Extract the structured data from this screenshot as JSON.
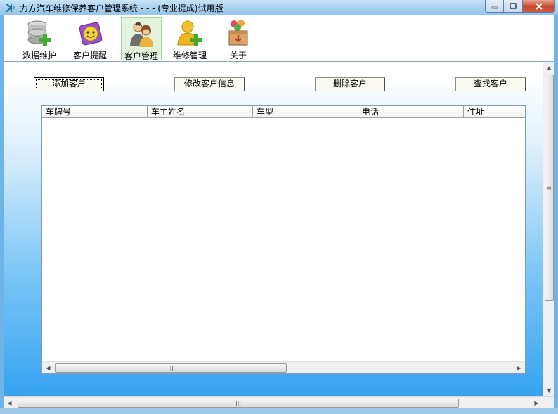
{
  "window": {
    "title": "力方汽车维修保养客户管理系统 - - - (专业提成)试用版"
  },
  "toolbar": {
    "items": [
      {
        "label": "数据维护",
        "icon": "database-add-icon"
      },
      {
        "label": "客户提醒",
        "icon": "reminder-face-icon"
      },
      {
        "label": "客户管理",
        "icon": "customers-icon",
        "active": true
      },
      {
        "label": "维修管理",
        "icon": "user-add-icon"
      },
      {
        "label": "关于",
        "icon": "about-box-icon"
      }
    ]
  },
  "actions": {
    "add": "添加客户",
    "edit": "修改客户信息",
    "delete": "删除客户",
    "search": "查找客户"
  },
  "table": {
    "columns": [
      "车牌号",
      "车主姓名",
      "车型",
      "电话",
      "住址"
    ],
    "rows": []
  },
  "colors": {
    "accent": "#35a3f1",
    "active_tab": "#e2f5dc"
  }
}
